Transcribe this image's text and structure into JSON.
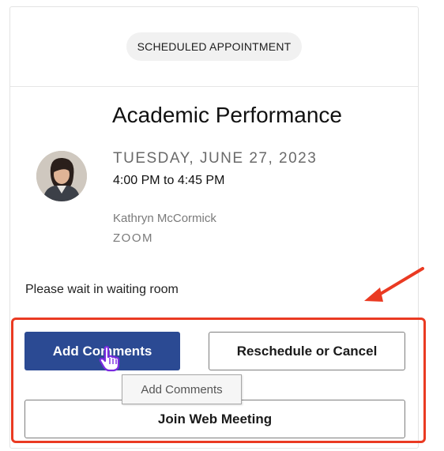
{
  "card": {
    "header_label": "SCHEDULED APPOINTMENT",
    "title": "Academic Performance",
    "date": "TUESDAY, JUNE 27, 2023",
    "time": "4:00 PM to 4:45 PM",
    "host": "Kathryn McCormick",
    "location": "ZOOM",
    "note": "Please wait in waiting room"
  },
  "actions": {
    "add_comments": "Add Comments",
    "reschedule": "Reschedule or Cancel",
    "join": "Join Web Meeting",
    "tooltip": "Add Comments"
  },
  "icons": {
    "avatar": "person-avatar",
    "cursor": "hand-pointer-icon",
    "arrow": "annotation-arrow-icon"
  },
  "colors": {
    "primary_button": "#2b4a93",
    "highlight": "#ea3a22",
    "cursor": "#7a2be0"
  }
}
